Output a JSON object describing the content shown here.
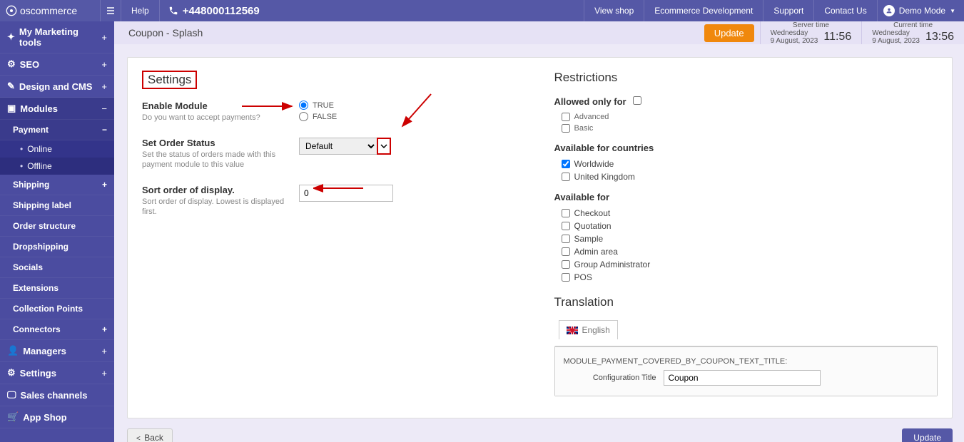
{
  "brand": "oscommerce",
  "topbar": {
    "help": "Help",
    "phone": "+448000112569",
    "links": [
      "View shop",
      "Ecommerce Development",
      "Support",
      "Contact Us"
    ],
    "demo_mode": "Demo Mode"
  },
  "subheader": {
    "title": "Coupon - Splash",
    "update": "Update",
    "server_time_label": "Server time",
    "server_day": "Wednesday",
    "server_date": "9 August, 2023",
    "server_time": "11:56",
    "current_time_label": "Current time",
    "current_day": "Wednesday",
    "current_date": "9 August, 2023",
    "current_time": "13:56"
  },
  "sidebar": {
    "items": [
      {
        "label": "My Marketing tools",
        "icon": "star"
      },
      {
        "label": "SEO",
        "icon": "seo"
      },
      {
        "label": "Design and CMS",
        "icon": "brush"
      },
      {
        "label": "Modules",
        "icon": "modules",
        "open": true,
        "children": [
          {
            "label": "Payment",
            "open": true,
            "subs": [
              "Online",
              "Offline"
            ]
          },
          {
            "label": "Shipping",
            "plus": true
          },
          {
            "label": "Shipping label"
          },
          {
            "label": "Order structure"
          },
          {
            "label": "Dropshipping"
          },
          {
            "label": "Socials"
          },
          {
            "label": "Extensions"
          },
          {
            "label": "Collection Points"
          },
          {
            "label": "Connectors",
            "plus": true
          }
        ]
      },
      {
        "label": "Managers",
        "icon": "user"
      },
      {
        "label": "Settings",
        "icon": "gear"
      },
      {
        "label": "Sales channels",
        "icon": "screen"
      },
      {
        "label": "App Shop",
        "icon": "cart"
      }
    ]
  },
  "settings": {
    "heading": "Settings",
    "enable_label": "Enable Module",
    "enable_desc": "Do you want to accept payments?",
    "true_label": "TRUE",
    "false_label": "FALSE",
    "enable_value": "TRUE",
    "status_label": "Set Order Status",
    "status_desc": "Set the status of orders made with this payment module to this value",
    "status_value": "Default",
    "sort_label": "Sort order of display.",
    "sort_desc": "Sort order of display. Lowest is displayed first.",
    "sort_value": "0"
  },
  "restrictions": {
    "heading": "Restrictions",
    "allowed_label": "Allowed only for",
    "allowed_items": [
      "Advanced",
      "Basic"
    ],
    "countries_label": "Available for countries",
    "countries": [
      {
        "label": "Worldwide",
        "checked": true
      },
      {
        "label": "United Kingdom",
        "checked": false
      }
    ],
    "avail_label": "Available for",
    "avail_items": [
      "Checkout",
      "Quotation",
      "Sample",
      "Admin area",
      "Group Administrator",
      "POS"
    ]
  },
  "translation": {
    "heading": "Translation",
    "tab": "English",
    "key": "MODULE_PAYMENT_COVERED_BY_COUPON_TEXT_TITLE:",
    "cfg_label": "Configuration Title",
    "cfg_value": "Coupon"
  },
  "footer": {
    "back": "Back",
    "update": "Update"
  }
}
